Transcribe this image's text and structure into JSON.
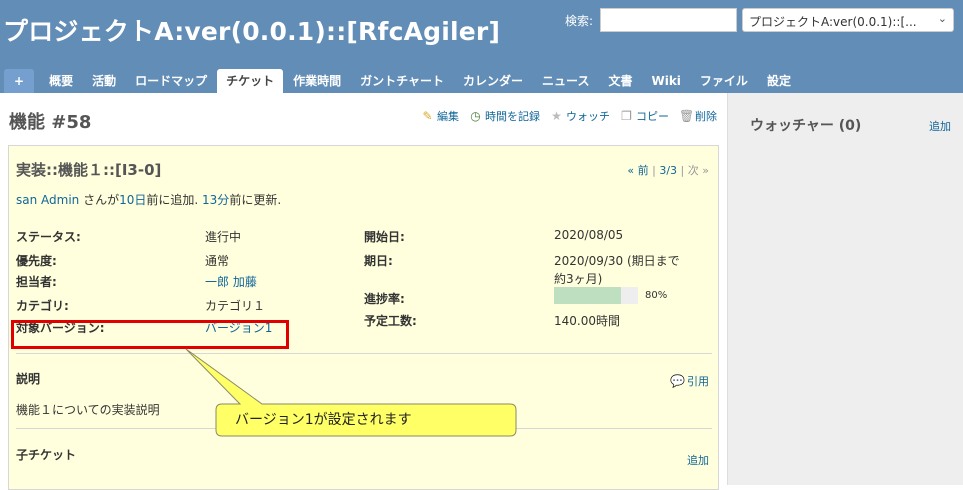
{
  "header": {
    "project_title": "プロジェクトA:ver(0.0.1)::[RfcAgiler]",
    "search_label": "検索:",
    "search_value": "",
    "project_select_value": "プロジェクトA:ver(0.0.1)::[..."
  },
  "tabs": [
    {
      "label": "+"
    },
    {
      "label": "概要"
    },
    {
      "label": "活動"
    },
    {
      "label": "ロードマップ"
    },
    {
      "label": "チケット",
      "selected": true
    },
    {
      "label": "作業時間"
    },
    {
      "label": "ガントチャート"
    },
    {
      "label": "カレンダー"
    },
    {
      "label": "ニュース"
    },
    {
      "label": "文書"
    },
    {
      "label": "Wiki"
    },
    {
      "label": "ファイル"
    },
    {
      "label": "設定"
    }
  ],
  "issue": {
    "title": "機能 #58",
    "actions": {
      "edit": "編集",
      "log_time": "時間を記録",
      "watch": "ウォッチ",
      "copy": "コピー",
      "delete": "削除"
    },
    "subject": "実装::機能１::[I3-0]",
    "pager": {
      "prev": "« 前",
      "sep1": "|",
      "position": "3/3",
      "sep2": "|",
      "next": "次 »"
    },
    "author_line": {
      "author": "san Admin",
      "text1": " さんが",
      "created_ago": "10日",
      "text2": "前に追加. ",
      "updated_ago": "13分",
      "text3": "前に更新."
    },
    "attributes": {
      "status_label": "ステータス:",
      "status_value": "進行中",
      "priority_label": "優先度:",
      "priority_value": "通常",
      "assignee_label": "担当者:",
      "assignee_value": "一郎 加藤",
      "category_label": "カテゴリ:",
      "category_value": "カテゴリ１",
      "version_label": "対象バージョン:",
      "version_value": "バージョン1",
      "start_label": "開始日:",
      "start_value": "2020/08/05",
      "due_label": "期日:",
      "due_value_line1": "2020/09/30 (期日まで",
      "due_value_line2": "約3ヶ月)",
      "progress_label": "進捗率:",
      "progress_value": 80,
      "progress_text": "80%",
      "estimated_label": "予定工数:",
      "estimated_value": "140.00時間"
    },
    "description": {
      "title": "説明",
      "quote": "引用",
      "text": "機能１についての実装説明"
    },
    "subtasks": {
      "title": "子チケット",
      "add": "追加"
    }
  },
  "sidebar": {
    "watchers_title": "ウォッチャー (0)",
    "add": "追加"
  },
  "annotation": {
    "callout_text": "バージョン1が設定されます",
    "callout_color": "#ffff66",
    "highlight_color": "#e00000"
  },
  "colors": {
    "header_bg": "#628db6",
    "tab_plus_bg": "#759fcf",
    "issue_bg": "#ffffdd",
    "progress_fill": "#bfe0c0",
    "link": "#169"
  }
}
